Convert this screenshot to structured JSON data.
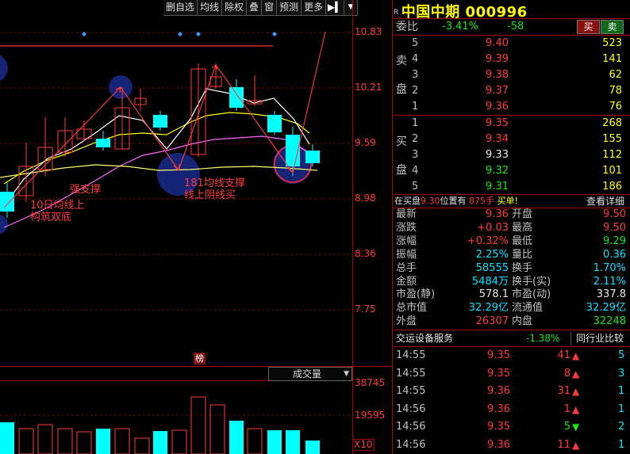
{
  "toolbar": {
    "buttons": [
      "删自选",
      "均线",
      "除权",
      "叠",
      "窗",
      "预测",
      "更多"
    ],
    "more_icon": "play-bar-icon",
    "dropdown_icon": "caret-down-icon"
  },
  "price_axis": [
    "10.83",
    "10.21",
    "9.59",
    "8.98",
    "8.36",
    "7.75"
  ],
  "volume_axis": [
    "38745",
    "19595"
  ],
  "volume_selector": "成交量",
  "volume_multiplier": "X10",
  "rank_badge": "榜",
  "annotations": {
    "strong_support": "强支撑",
    "ma10_line1": "10日均线上",
    "ma10_line2": "构筑双底",
    "ma181_line1": "181均线支撑",
    "ma181_line2": "线上阴线买"
  },
  "stock": {
    "flag": "R",
    "name": "中国中期",
    "code": "000996"
  },
  "weibi": {
    "label": "委比",
    "percent": "-3.41%",
    "diff": "-58",
    "buy_btn": "买",
    "sell_btn": "卖"
  },
  "order_book": {
    "sell_side_label": [
      "卖",
      "盘"
    ],
    "buy_side_label": [
      "买",
      "盘"
    ],
    "sell": [
      {
        "level": "5",
        "price": "9.40",
        "vol": "523"
      },
      {
        "level": "4",
        "price": "9.39",
        "vol": "141"
      },
      {
        "level": "3",
        "price": "9.38",
        "vol": "62"
      },
      {
        "level": "2",
        "price": "9.37",
        "vol": "78"
      },
      {
        "level": "1",
        "price": "9.36",
        "vol": "76"
      }
    ],
    "buy": [
      {
        "level": "1",
        "price": "9.35",
        "vol": "268"
      },
      {
        "level": "2",
        "price": "9.34",
        "vol": "155"
      },
      {
        "level": "3",
        "price": "9.33",
        "vol": "112"
      },
      {
        "level": "4",
        "price": "9.32",
        "vol": "101"
      },
      {
        "level": "5",
        "price": "9.31",
        "vol": "186"
      }
    ]
  },
  "info_line": {
    "prefix": "在买盘",
    "price": "9.30",
    "middle": "位置有",
    "qty": "875手",
    "suffix": "买单!",
    "link": "查看详细"
  },
  "stats": [
    {
      "l1": "最新",
      "v1": "9.36",
      "c1": "red",
      "l2": "开盘",
      "v2": "9.50",
      "c2": "red"
    },
    {
      "l1": "涨跌",
      "v1": "+0.03",
      "c1": "red",
      "l2": "最高",
      "v2": "9.50",
      "c2": "red"
    },
    {
      "l1": "涨幅",
      "v1": "+0.32%",
      "c1": "red",
      "l2": "最低",
      "v2": "9.29",
      "c2": "green"
    },
    {
      "l1": "振幅",
      "v1": "2.25%",
      "c1": "cyan",
      "l2": "量比",
      "v2": "0.36",
      "c2": "cyan"
    },
    {
      "l1": "总手",
      "v1": "58555",
      "c1": "cyan",
      "l2": "换手",
      "v2": "1.70%",
      "c2": "cyan"
    },
    {
      "l1": "金额",
      "v1": "5484万",
      "c1": "cyan",
      "l2": "换手(实)",
      "v2": "2.11%",
      "c2": "cyan"
    },
    {
      "l1": "市盈(静)",
      "v1": "578.1",
      "c1": "white",
      "l2": "市盈(动)",
      "v2": "337.8",
      "c2": "white"
    },
    {
      "l1": "总市值",
      "v1": "32.29亿",
      "c1": "cyan",
      "l2": "流通值",
      "v2": "32.29亿",
      "c2": "cyan"
    },
    {
      "l1": "外盘",
      "v1": "26307",
      "c1": "red",
      "l2": "内盘",
      "v2": "32248",
      "c2": "green"
    }
  ],
  "sector": {
    "name": "交运设备服务",
    "change": "-1.38%",
    "compare": "同行业比较"
  },
  "trades": [
    {
      "time": "14:55",
      "price": "9.35",
      "qty": "41",
      "dir": "up",
      "num": "5"
    },
    {
      "time": "14:55",
      "price": "9.35",
      "qty": "8",
      "dir": "up",
      "num": "3"
    },
    {
      "time": "14:55",
      "price": "9.36",
      "qty": "31",
      "dir": "up",
      "num": "1"
    },
    {
      "time": "14:56",
      "price": "9.36",
      "qty": "1",
      "dir": "up",
      "num": "1"
    },
    {
      "time": "14:56",
      "price": "9.35",
      "qty": "5",
      "dir": "down",
      "num": "2"
    },
    {
      "time": "14:56",
      "price": "9.36",
      "qty": "11",
      "dir": "up",
      "num": "1"
    }
  ],
  "colors": {
    "up": "#ff3b3b",
    "down": "#14e514",
    "flat_candle": "#00ffff",
    "ma5": "#ffffff",
    "ma10": "#ffff00",
    "ma20": "#ff66ff",
    "ma181": "#ffff66"
  }
}
